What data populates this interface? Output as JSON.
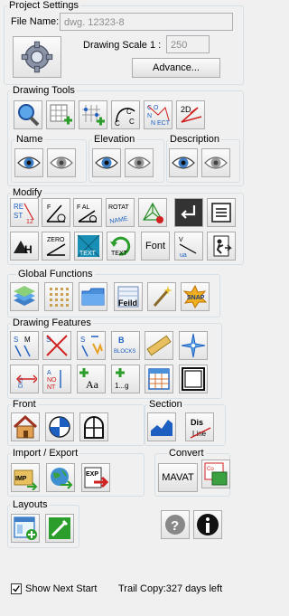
{
  "project": {
    "title": "Project Settings",
    "file_name_label": "File Name:",
    "file_name_value": "dwg. 12323-8",
    "scale_label": "Drawing Scale",
    "scale_prefix": "1 :",
    "scale_value": "250",
    "advance_label": "Advance..."
  },
  "groups": {
    "drawing_tools": "Drawing Tools",
    "name": "Name",
    "elevation": "Elevation",
    "description": "Description",
    "modify": "Modify",
    "global_functions": "Global Functions",
    "drawing_features": "Drawing Features",
    "front": "Front",
    "section": "Section",
    "import_export": "Import / Export",
    "convert": "Convert",
    "layouts": "Layouts"
  },
  "buttons": {
    "font_label": "Font",
    "mavat_label": "MAVAT",
    "text_label": "TEXT",
    "snap_label": "SNAP",
    "feild_label": "Feild",
    "imp_label": "IMP",
    "exp_label": "EXP",
    "dis_label": "Dis",
    "line_label": "Line",
    "blocks_label": "BLOCKS",
    "zero_label": "ZERO",
    "rotat_label": "ROTAT",
    "name_label": "NAME"
  },
  "footer": {
    "show_next_start_label": "Show Next Start",
    "show_next_start_checked": true,
    "trial_text": "Trail Copy:327 days left"
  },
  "colors": {
    "background": "#f0f0f0",
    "accent_blue": "#1d5fc0",
    "group_border": "#d5dfe5"
  }
}
